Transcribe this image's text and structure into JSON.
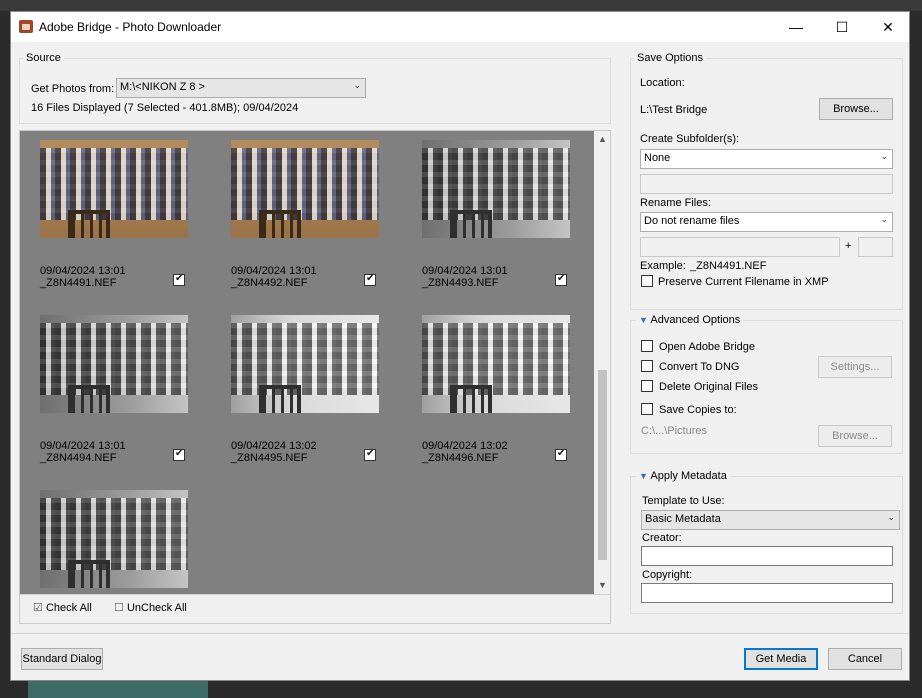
{
  "window": {
    "title": "Adobe Bridge - Photo Downloader",
    "minimize": "—",
    "maximize": "☐",
    "close": "✕"
  },
  "source": {
    "group_title": "Source",
    "get_photos_label": "Get Photos from:",
    "device": "M:\\<NIKON Z 8  >",
    "summary": "16 Files Displayed (7 Selected - 401.8MB); 09/04/2024"
  },
  "thumbnails": [
    {
      "date": "09/04/2024 13:01",
      "name": "_Z8N4491.NEF",
      "checked": true,
      "tone": "color"
    },
    {
      "date": "09/04/2024 13:01",
      "name": "_Z8N4492.NEF",
      "checked": true,
      "tone": "color"
    },
    {
      "date": "09/04/2024 13:01",
      "name": "_Z8N4493.NEF",
      "checked": true,
      "tone": "gray"
    },
    {
      "date": "09/04/2024 13:01",
      "name": "_Z8N4494.NEF",
      "checked": true,
      "tone": "gray"
    },
    {
      "date": "09/04/2024 13:02",
      "name": "_Z8N4495.NEF",
      "checked": true,
      "tone": "bright"
    },
    {
      "date": "09/04/2024 13:02",
      "name": "_Z8N4496.NEF",
      "checked": true,
      "tone": "bright"
    },
    {
      "date": "",
      "name": "",
      "checked": false,
      "tone": "gray"
    }
  ],
  "gallery_footer": {
    "check_all": "Check All",
    "uncheck_all": "UnCheck All"
  },
  "save_options": {
    "group_title": "Save Options",
    "location_label": "Location:",
    "location_value": "L:\\Test Bridge",
    "browse_label": "Browse...",
    "subfolder_label": "Create Subfolder(s):",
    "subfolder_value": "None",
    "rename_label": "Rename Files:",
    "rename_value": "Do not rename files",
    "plus": "+",
    "example_label": "Example:",
    "example_value": "_Z8N4491.NEF",
    "preserve_label": "Preserve Current Filename in XMP"
  },
  "advanced": {
    "group_title": "Advanced Options",
    "open_bridge": "Open Adobe Bridge",
    "convert_dng": "Convert To DNG",
    "settings": "Settings...",
    "delete_originals": "Delete Original Files",
    "save_copies": "Save Copies to:",
    "copies_path": "C:\\...\\Pictures",
    "browse_label": "Browse..."
  },
  "metadata": {
    "group_title": "Apply Metadata",
    "template_label": "Template to Use:",
    "template_value": "Basic Metadata",
    "creator_label": "Creator:",
    "creator_value": "",
    "copyright_label": "Copyright:",
    "copyright_value": ""
  },
  "footer": {
    "standard_dialog": "Standard Dialog",
    "get_media": "Get Media",
    "cancel": "Cancel"
  }
}
